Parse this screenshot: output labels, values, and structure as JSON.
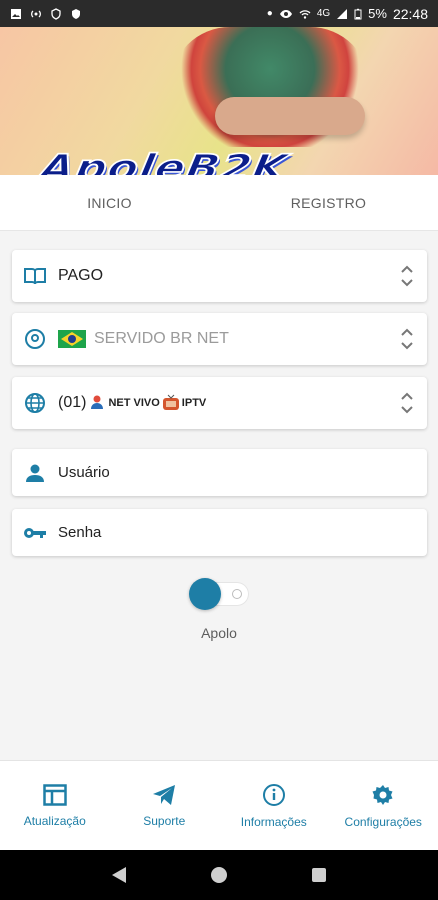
{
  "status_bar": {
    "battery": "5%",
    "network": "4G",
    "time": "22:48"
  },
  "banner": {
    "logo_text": "ApoleB2K"
  },
  "tabs": [
    {
      "label": "INICIO"
    },
    {
      "label": "REGISTRO"
    }
  ],
  "form": {
    "plan": {
      "value": "PAGO"
    },
    "server": {
      "value": "SERVIDO BR NET"
    },
    "network": {
      "prefix": "(01)",
      "name1": "NET VIVO",
      "name2": "IPTV"
    },
    "username": {
      "placeholder": "Usuário"
    },
    "password": {
      "placeholder": "Senha"
    },
    "toggle": {
      "label": "Apolo"
    }
  },
  "bottom_nav": [
    {
      "label": "Atualização",
      "icon": "update-icon"
    },
    {
      "label": "Suporte",
      "icon": "telegram-icon"
    },
    {
      "label": "Informações",
      "icon": "info-icon"
    },
    {
      "label": "Configurações",
      "icon": "gear-icon"
    }
  ],
  "colors": {
    "accent": "#1e7ea6",
    "status_bar": "#2b2b2b"
  }
}
